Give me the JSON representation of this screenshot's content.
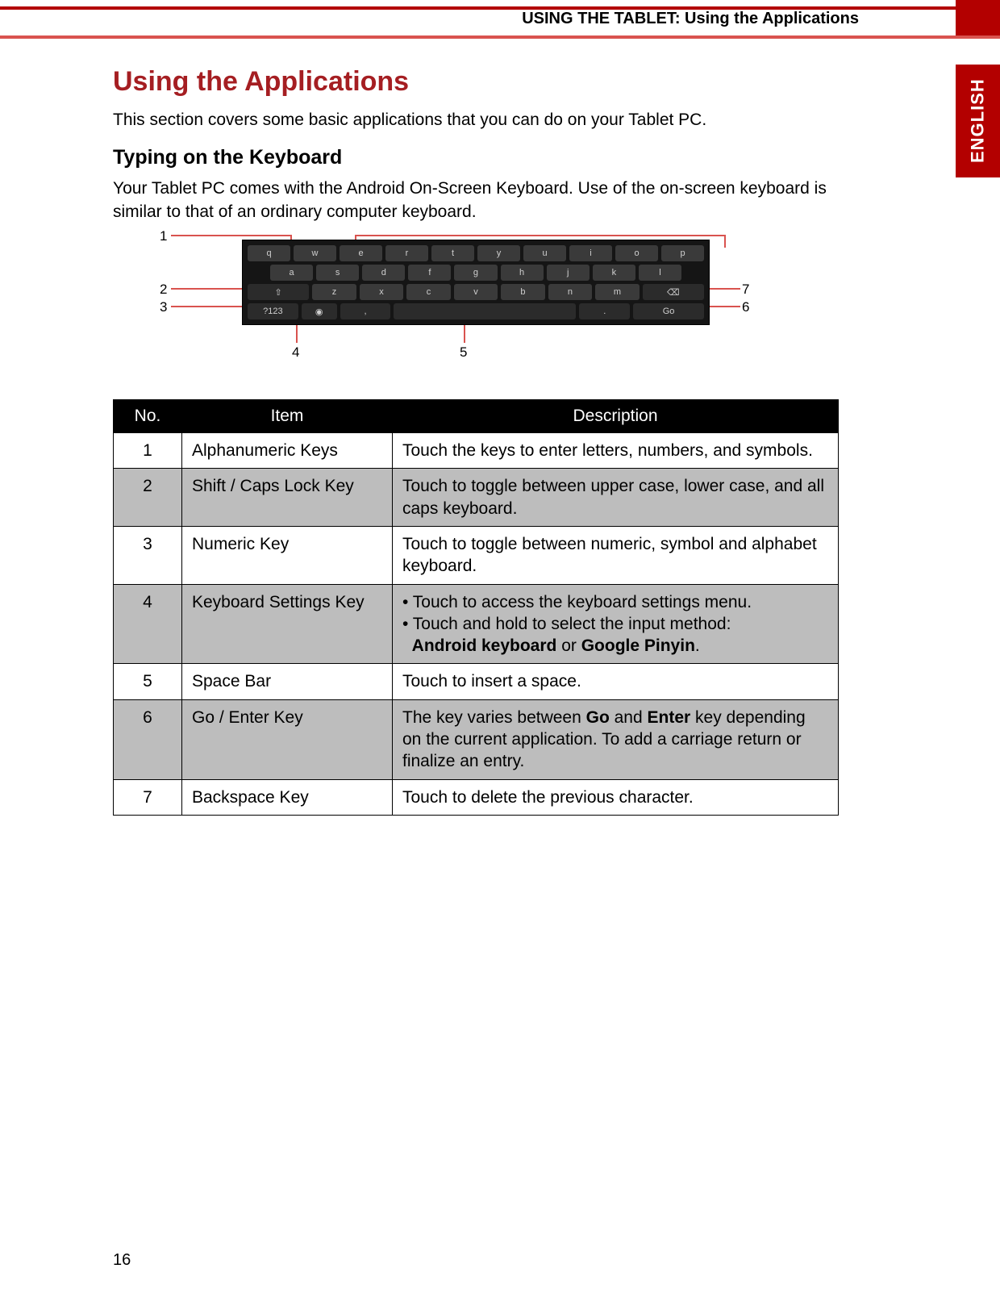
{
  "header": {
    "breadcrumb": "USING THE TABLET: Using the Applications",
    "language_tab": "ENGLISH"
  },
  "title": "Using the Applications",
  "intro": "This section covers some basic applications that you can do on your Tablet PC.",
  "section_heading": "Typing on the Keyboard",
  "section_desc": "Your Tablet PC comes with the Android On-Screen Keyboard. Use of the on-screen keyboard is similar to that of an ordinary computer keyboard.",
  "keyboard": {
    "row1": [
      "q",
      "w",
      "e",
      "r",
      "t",
      "y",
      "u",
      "i",
      "o",
      "p"
    ],
    "row2": [
      "a",
      "s",
      "d",
      "f",
      "g",
      "h",
      "j",
      "k",
      "l"
    ],
    "row3_shift": "⇧",
    "row3": [
      "z",
      "x",
      "c",
      "v",
      "b",
      "n",
      "m"
    ],
    "row3_back": "⌫",
    "row4_num": "?123",
    "row4_set": "◉",
    "row4_comma": ",",
    "row4_space": "",
    "row4_period": ".",
    "row4_go": "Go"
  },
  "callouts": {
    "c1": "1",
    "c2": "2",
    "c3": "3",
    "c4": "4",
    "c5": "5",
    "c6": "6",
    "c7": "7"
  },
  "table": {
    "headers": {
      "no": "No.",
      "item": "Item",
      "desc": "Description"
    },
    "rows": [
      {
        "no": "1",
        "item": "Alphanumeric Keys",
        "desc": "Touch the keys to enter letters, numbers, and symbols."
      },
      {
        "no": "2",
        "item": "Shift / Caps Lock Key",
        "desc": "Touch to toggle between upper case, lower case, and all caps keyboard."
      },
      {
        "no": "3",
        "item": "Numeric Key",
        "desc": "Touch to toggle between numeric, symbol and alphabet keyboard."
      },
      {
        "no": "4",
        "item": "Keyboard Settings Key",
        "desc_parts": {
          "line1": "• Touch to access the keyboard settings menu.",
          "line2a": "• Touch and hold to select the input method:",
          "bold1": "Android keyboard",
          "or": " or ",
          "bold2": "Google Pinyin",
          "end": "."
        }
      },
      {
        "no": "5",
        "item": "Space Bar",
        "desc": "Touch to insert a space."
      },
      {
        "no": "6",
        "item": "Go / Enter Key",
        "desc_parts": {
          "pre": "The key varies between ",
          "b1": "Go",
          "mid": " and ",
          "b2": "Enter",
          "post": " key depending on the current application. To add a carriage return or finalize an entry."
        }
      },
      {
        "no": "7",
        "item": "Backspace Key",
        "desc": "Touch to delete the previous character."
      }
    ]
  },
  "page_number": "16"
}
